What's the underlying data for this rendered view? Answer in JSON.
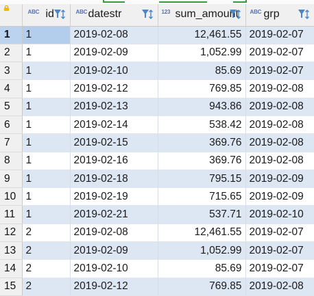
{
  "colors": {
    "header_bg": "#f0f0f0",
    "row_band": "#dde6f3",
    "row_plain": "#ffffff",
    "selected_row_header": "#bcd3ef",
    "selected_cell": "#b3cdec",
    "type_icon": "#5a6fb0",
    "filter_icon": "#4a86c8",
    "lock_icon": "#f2b800"
  },
  "grid": {
    "corner_icon": "lock-icon",
    "columns": [
      {
        "key": "id",
        "title": "id",
        "type_badge": "ABC",
        "filter_icon": "filter-sort-icon"
      },
      {
        "key": "datestr",
        "title": "datestr",
        "type_badge": "ABC",
        "filter_icon": "filter-sort-icon"
      },
      {
        "key": "sum_amount",
        "title": "sum_amount",
        "type_badge": "123",
        "filter_icon": "filter-sort-icon"
      },
      {
        "key": "grp",
        "title": "grp",
        "type_badge": "ABC",
        "filter_icon": "filter-sort-icon"
      }
    ],
    "selected_row": 1,
    "rows": [
      {
        "n": "1",
        "id": "1",
        "datestr": "2019-02-08",
        "sum_amount": "12,461.55",
        "grp": "2019-02-07"
      },
      {
        "n": "2",
        "id": "1",
        "datestr": "2019-02-09",
        "sum_amount": "1,052.99",
        "grp": "2019-02-07"
      },
      {
        "n": "3",
        "id": "1",
        "datestr": "2019-02-10",
        "sum_amount": "85.69",
        "grp": "2019-02-07"
      },
      {
        "n": "4",
        "id": "1",
        "datestr": "2019-02-12",
        "sum_amount": "769.85",
        "grp": "2019-02-08"
      },
      {
        "n": "5",
        "id": "1",
        "datestr": "2019-02-13",
        "sum_amount": "943.86",
        "grp": "2019-02-08"
      },
      {
        "n": "6",
        "id": "1",
        "datestr": "2019-02-14",
        "sum_amount": "538.42",
        "grp": "2019-02-08"
      },
      {
        "n": "7",
        "id": "1",
        "datestr": "2019-02-15",
        "sum_amount": "369.76",
        "grp": "2019-02-08"
      },
      {
        "n": "8",
        "id": "1",
        "datestr": "2019-02-16",
        "sum_amount": "369.76",
        "grp": "2019-02-08"
      },
      {
        "n": "9",
        "id": "1",
        "datestr": "2019-02-18",
        "sum_amount": "795.15",
        "grp": "2019-02-09"
      },
      {
        "n": "10",
        "id": "1",
        "datestr": "2019-02-19",
        "sum_amount": "715.65",
        "grp": "2019-02-09"
      },
      {
        "n": "11",
        "id": "1",
        "datestr": "2019-02-21",
        "sum_amount": "537.71",
        "grp": "2019-02-10"
      },
      {
        "n": "12",
        "id": "2",
        "datestr": "2019-02-08",
        "sum_amount": "12,461.55",
        "grp": "2019-02-07"
      },
      {
        "n": "13",
        "id": "2",
        "datestr": "2019-02-09",
        "sum_amount": "1,052.99",
        "grp": "2019-02-07"
      },
      {
        "n": "14",
        "id": "2",
        "datestr": "2019-02-10",
        "sum_amount": "85.69",
        "grp": "2019-02-07"
      },
      {
        "n": "15",
        "id": "2",
        "datestr": "2019-02-12",
        "sum_amount": "769.85",
        "grp": "2019-02-08"
      }
    ]
  }
}
